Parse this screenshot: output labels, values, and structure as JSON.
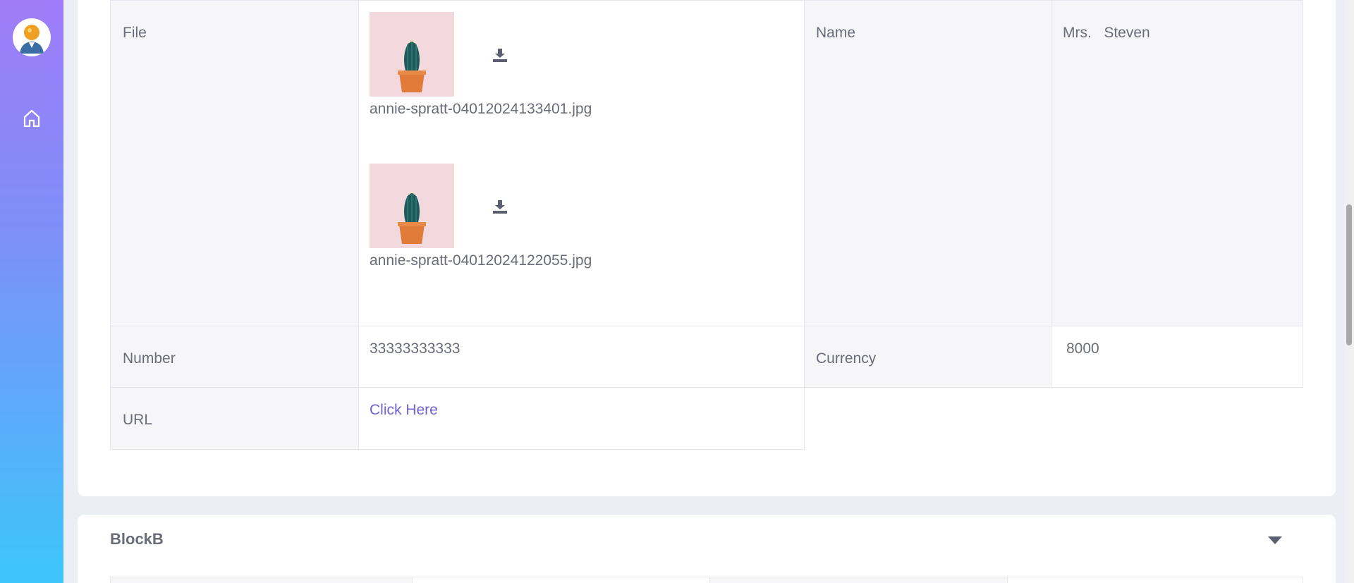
{
  "sidebar": {
    "avatar_icon": "user-avatar-icon",
    "home_icon": "home-icon"
  },
  "block_a": {
    "rows": {
      "file": {
        "label": "File",
        "files": [
          {
            "name": "annie-spratt-04012024133401.jpg"
          },
          {
            "name": "annie-spratt-04012024122055.jpg"
          }
        ]
      },
      "name": {
        "label": "Name",
        "value": "Mrs.   Steven"
      },
      "number": {
        "label": "Number",
        "value": "33333333333"
      },
      "currency": {
        "label": "Currency",
        "value": "8000"
      },
      "url": {
        "label": "URL",
        "value": "Click Here"
      }
    }
  },
  "block_b": {
    "title": "BlockB"
  },
  "colors": {
    "accent_link": "#6f62d6",
    "sidebar_top": "#a07cf8",
    "sidebar_bottom": "#3cc6fb"
  }
}
